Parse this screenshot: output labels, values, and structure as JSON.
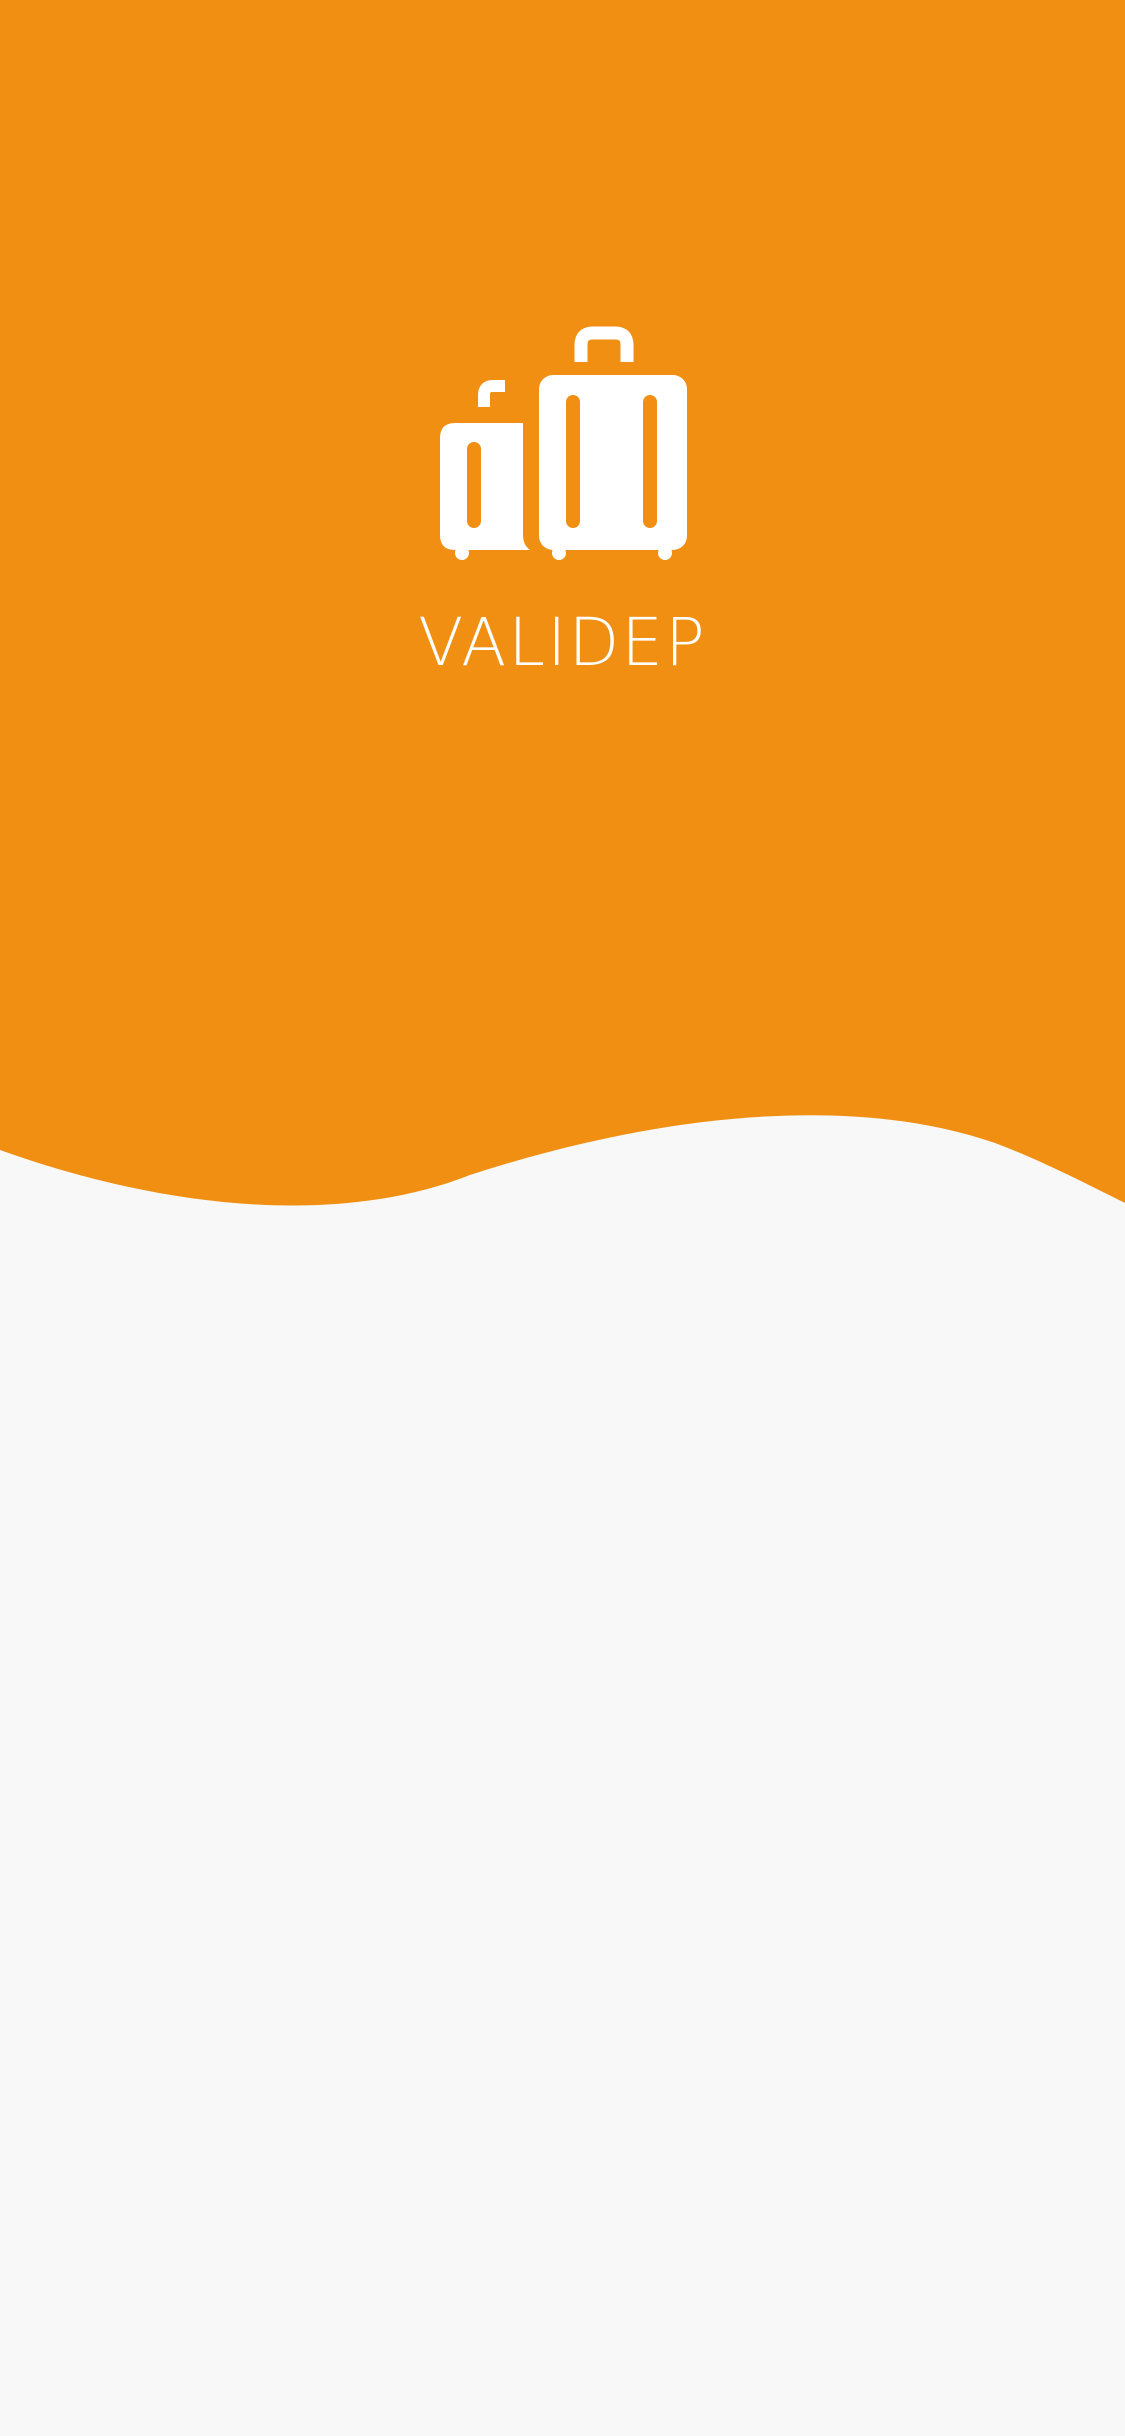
{
  "app": {
    "name": "VALIDEP",
    "logo_icon": "luggage-icon"
  },
  "colors": {
    "brand": "#f08f11",
    "background": "#f8f8f8",
    "foreground": "#ffffff"
  }
}
